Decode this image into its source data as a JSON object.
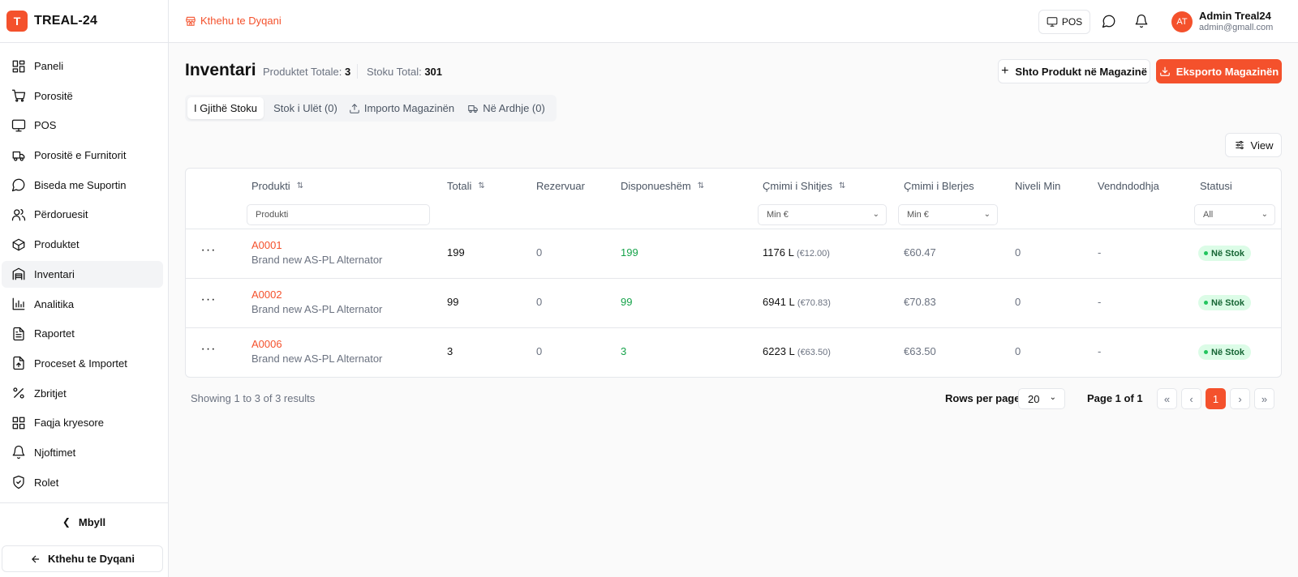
{
  "brand": {
    "logo_letter": "T",
    "name": "TREAL-24"
  },
  "sidebar": {
    "items": [
      {
        "label": "Paneli",
        "icon": "dashboard-icon"
      },
      {
        "label": "Porositë",
        "icon": "cart-icon"
      },
      {
        "label": "POS",
        "icon": "monitor-icon"
      },
      {
        "label": "Porositë e Furnitorit",
        "icon": "truck-icon"
      },
      {
        "label": "Biseda me Suportin",
        "icon": "chat-icon"
      },
      {
        "label": "Përdoruesit",
        "icon": "users-icon"
      },
      {
        "label": "Produktet",
        "icon": "box-icon"
      },
      {
        "label": "Inventari",
        "icon": "warehouse-icon",
        "active": true
      },
      {
        "label": "Analitika",
        "icon": "chart-icon"
      },
      {
        "label": "Raportet",
        "icon": "document-icon"
      },
      {
        "label": "Proceset & Importet",
        "icon": "file-upload-icon"
      },
      {
        "label": "Zbritjet",
        "icon": "percent-icon"
      },
      {
        "label": "Faqja kryesore",
        "icon": "grid-icon"
      },
      {
        "label": "Njoftimet",
        "icon": "bell-icon"
      },
      {
        "label": "Rolet",
        "icon": "shield-icon"
      }
    ],
    "collapse_label": "Mbyll",
    "back_label": "Kthehu te Dyqani"
  },
  "header": {
    "back_to_shop": "Kthehu te Dyqani",
    "pos_label": "POS",
    "user": {
      "initials": "AT",
      "name": "Admin Treal24",
      "email": "admin@gmall.com"
    }
  },
  "page": {
    "title": "Inventari",
    "total_products_label": "Produktet Totale:",
    "total_products": "3",
    "total_stock_label": "Stoku Total:",
    "total_stock": "301",
    "add_button": "Shto Produkt në Magazinë",
    "export_button": "Eksporto Magazinën",
    "view_button": "View"
  },
  "tabs": [
    {
      "label": "I Gjithë Stoku",
      "active": true
    },
    {
      "label": "Stok i Ulët (0)"
    },
    {
      "label": "Importo Magazinën",
      "icon": "upload-icon"
    },
    {
      "label": "Në Ardhje (0)",
      "icon": "truck-icon"
    }
  ],
  "table": {
    "columns": [
      "Produkti",
      "Totali",
      "Rezervuar",
      "Disponueshëm",
      "Çmimi i Shitjes",
      "Çmimi i Blerjes",
      "Niveli Min",
      "Vendndodhja",
      "Statusi"
    ],
    "filters": {
      "product_placeholder": "Produkti",
      "sell_min": "Min €",
      "buy_min": "Min €",
      "status": "All"
    },
    "rows": [
      {
        "sku": "A0001",
        "name": "Brand new AS-PL Alternator",
        "total": "199",
        "reserved": "0",
        "available": "199",
        "sell_price": "1176 L",
        "sell_price_eur": "(€12.00)",
        "buy_price": "€60.47",
        "min_level": "0",
        "location": "-",
        "status": "Në Stok"
      },
      {
        "sku": "A0002",
        "name": "Brand new AS-PL Alternator",
        "total": "99",
        "reserved": "0",
        "available": "99",
        "sell_price": "6941 L",
        "sell_price_eur": "(€70.83)",
        "buy_price": "€70.83",
        "min_level": "0",
        "location": "-",
        "status": "Në Stok"
      },
      {
        "sku": "A0006",
        "name": "Brand new AS-PL Alternator",
        "total": "3",
        "reserved": "0",
        "available": "3",
        "sell_price": "6223 L",
        "sell_price_eur": "(€63.50)",
        "buy_price": "€63.50",
        "min_level": "0",
        "location": "-",
        "status": "Në Stok"
      }
    ]
  },
  "pagination": {
    "results_text": "Showing 1 to 3 of 3 results",
    "rows_per_page_label": "Rows per page",
    "rows_per_page": "20",
    "page_text": "Page 1 of 1",
    "current_page": "1",
    "first": "«",
    "prev": "‹",
    "next": "›",
    "last": "»"
  },
  "colors": {
    "accent": "#f4512c",
    "success": "#16a34a",
    "badge_bg": "#dcfce7"
  }
}
